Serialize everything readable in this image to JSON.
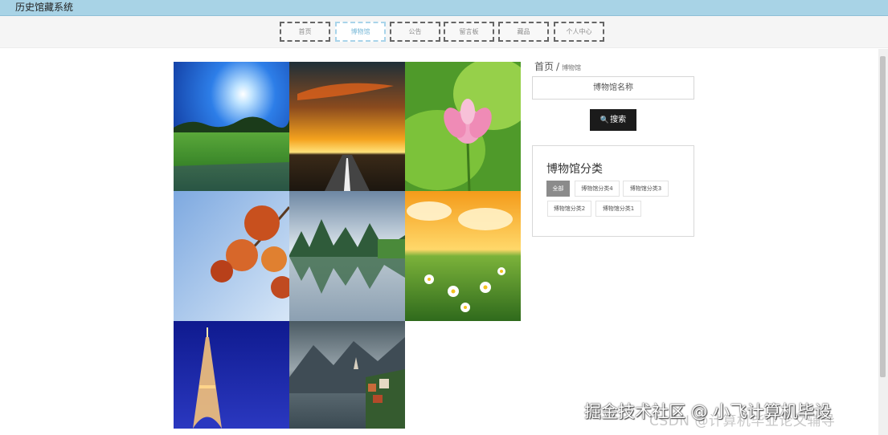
{
  "app": {
    "title": "历史馆藏系统"
  },
  "nav": {
    "items": [
      {
        "label": "首页",
        "active": false
      },
      {
        "label": "博物馆",
        "active": true
      },
      {
        "label": "公告",
        "active": false
      },
      {
        "label": "留言板",
        "active": false
      },
      {
        "label": "藏品",
        "active": false
      },
      {
        "label": "个人中心",
        "active": false
      }
    ]
  },
  "breadcrumb": {
    "home": "首页",
    "separator": "/",
    "current": "博物馆"
  },
  "search": {
    "placeholder": "博物馆名称",
    "button_label": "搜索",
    "button_icon": "search-icon"
  },
  "categories": {
    "title": "博物馆分类",
    "tags": [
      {
        "label": "全部",
        "active": true
      },
      {
        "label": "博物馆分类4",
        "active": false
      },
      {
        "label": "博物馆分类3",
        "active": false
      },
      {
        "label": "博物馆分类2",
        "active": false
      },
      {
        "label": "博物馆分类1",
        "active": false
      }
    ]
  },
  "gallery": {
    "items": [
      {
        "scene": "sunny-field"
      },
      {
        "scene": "sunset-road"
      },
      {
        "scene": "lotus-flower"
      },
      {
        "scene": "autumn-maple"
      },
      {
        "scene": "karst-lake"
      },
      {
        "scene": "daisy-meadow"
      },
      {
        "scene": "eiffel-tower"
      },
      {
        "scene": "mountain-village"
      }
    ]
  },
  "watermarks": {
    "csdn": "CSDN @计算机毕业论文辅导",
    "juejin": "掘金技术社区 @ 小飞计算机毕设"
  }
}
